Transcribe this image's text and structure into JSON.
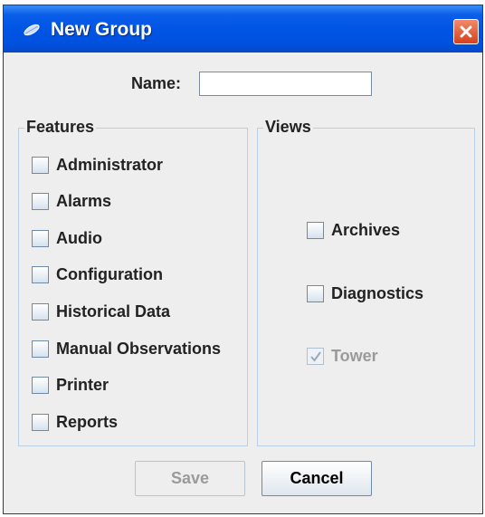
{
  "window": {
    "title": "New Group",
    "close_icon": "close-icon",
    "app_icon": "leaf-icon"
  },
  "name_field": {
    "label": "Name:",
    "value": ""
  },
  "features": {
    "legend": "Features",
    "items": [
      {
        "label": "Administrator",
        "checked": false,
        "enabled": true
      },
      {
        "label": "Alarms",
        "checked": false,
        "enabled": true
      },
      {
        "label": "Audio",
        "checked": false,
        "enabled": true
      },
      {
        "label": "Configuration",
        "checked": false,
        "enabled": true
      },
      {
        "label": "Historical Data",
        "checked": false,
        "enabled": true
      },
      {
        "label": "Manual Observations",
        "checked": false,
        "enabled": true
      },
      {
        "label": "Printer",
        "checked": false,
        "enabled": true
      },
      {
        "label": "Reports",
        "checked": false,
        "enabled": true
      }
    ]
  },
  "views": {
    "legend": "Views",
    "items": [
      {
        "label": "Archives",
        "checked": false,
        "enabled": true
      },
      {
        "label": "Diagnostics",
        "checked": false,
        "enabled": true
      },
      {
        "label": "Tower",
        "checked": true,
        "enabled": false
      }
    ]
  },
  "buttons": {
    "save": "Save",
    "cancel": "Cancel"
  },
  "colors": {
    "title_bar": "#0055e5",
    "close_button": "#d8401c",
    "panel_border": "#b8cfe5",
    "disabled_text": "#9a9a9a"
  }
}
